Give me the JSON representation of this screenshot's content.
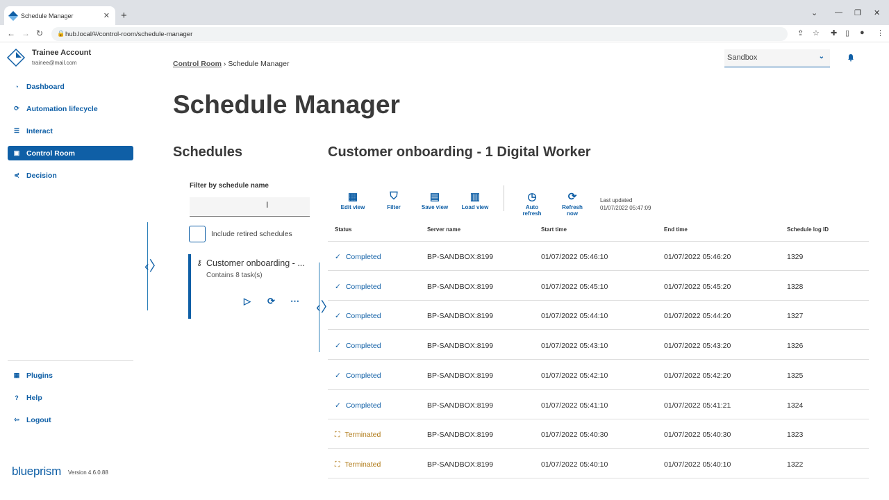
{
  "browser": {
    "tab_title": "Schedule Manager",
    "url": "hub.local/#/control-room/schedule-manager"
  },
  "account": {
    "name": "Trainee Account",
    "email": "trainee@mail.com"
  },
  "nav": [
    {
      "label": "Dashboard",
      "icon": "dashboard-icon"
    },
    {
      "label": "Automation lifecycle",
      "icon": "lifecycle-icon"
    },
    {
      "label": "Interact",
      "icon": "interact-icon"
    },
    {
      "label": "Control Room",
      "icon": "control-room-icon"
    },
    {
      "label": "Decision",
      "icon": "decision-icon"
    }
  ],
  "nav_bottom": [
    {
      "label": "Plugins",
      "icon": "plugins-icon"
    },
    {
      "label": "Help",
      "icon": "help-icon"
    },
    {
      "label": "Logout",
      "icon": "logout-icon"
    }
  ],
  "brand": {
    "name": "blueprism",
    "version": "Version 4.6.0.88"
  },
  "breadcrumb": {
    "parent": "Control Room",
    "sep": "›",
    "current": "Schedule Manager"
  },
  "environment": {
    "selected": "Sandbox"
  },
  "page_title": "Schedule Manager",
  "schedules": {
    "heading": "Schedules",
    "filter_label": "Filter by schedule name",
    "filter_value": "",
    "include_retired_label": "Include retired schedules",
    "card": {
      "name": "Customer onboarding - ...",
      "subtitle": "Contains 8 task(s)"
    }
  },
  "detail": {
    "heading": "Customer onboarding - 1 Digital Worker",
    "toolbar": {
      "edit_view": "Edit view",
      "filter": "Filter",
      "save_view": "Save view",
      "load_view": "Load view",
      "auto_refresh_1": "Auto",
      "auto_refresh_2": "refresh",
      "refresh_now_1": "Refresh",
      "refresh_now_2": "now"
    },
    "last_updated_label": "Last updated",
    "last_updated_value": "01/07/2022 05:47:09",
    "columns": [
      "Status",
      "Server name",
      "Start time",
      "End time",
      "Schedule log ID"
    ],
    "rows": [
      {
        "status": "Completed",
        "server": "BP-SANDBOX:8199",
        "start": "01/07/2022 05:46:10",
        "end": "01/07/2022 05:46:20",
        "id": "1329"
      },
      {
        "status": "Completed",
        "server": "BP-SANDBOX:8199",
        "start": "01/07/2022 05:45:10",
        "end": "01/07/2022 05:45:20",
        "id": "1328"
      },
      {
        "status": "Completed",
        "server": "BP-SANDBOX:8199",
        "start": "01/07/2022 05:44:10",
        "end": "01/07/2022 05:44:20",
        "id": "1327"
      },
      {
        "status": "Completed",
        "server": "BP-SANDBOX:8199",
        "start": "01/07/2022 05:43:10",
        "end": "01/07/2022 05:43:20",
        "id": "1326"
      },
      {
        "status": "Completed",
        "server": "BP-SANDBOX:8199",
        "start": "01/07/2022 05:42:10",
        "end": "01/07/2022 05:42:20",
        "id": "1325"
      },
      {
        "status": "Completed",
        "server": "BP-SANDBOX:8199",
        "start": "01/07/2022 05:41:10",
        "end": "01/07/2022 05:41:21",
        "id": "1324"
      },
      {
        "status": "Terminated",
        "server": "BP-SANDBOX:8199",
        "start": "01/07/2022 05:40:30",
        "end": "01/07/2022 05:40:30",
        "id": "1323"
      },
      {
        "status": "Terminated",
        "server": "BP-SANDBOX:8199",
        "start": "01/07/2022 05:40:10",
        "end": "01/07/2022 05:40:10",
        "id": "1322"
      }
    ]
  },
  "colors": {
    "accent": "#0f5fa6",
    "terminated": "#b07a17"
  }
}
